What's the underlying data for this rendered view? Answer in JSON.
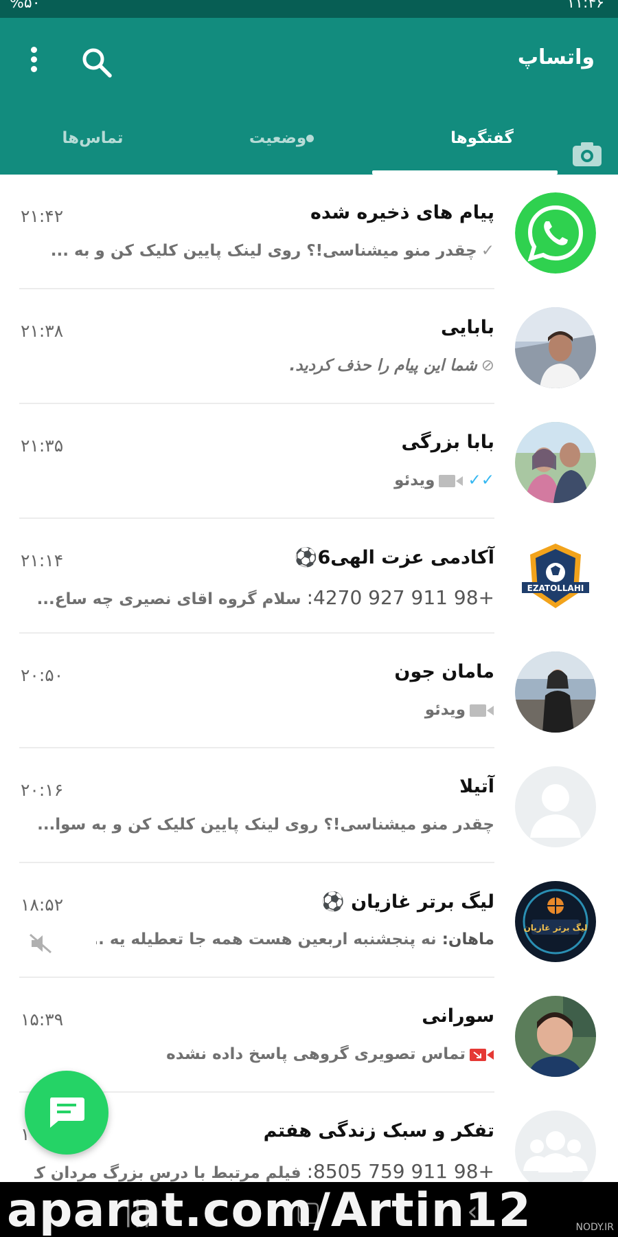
{
  "status_bar": {
    "left_text": "%۵۰",
    "right_text": "۱۱:۴۶"
  },
  "header": {
    "app_title": "واتساپ",
    "tabs": [
      {
        "label": "گفتگوها",
        "active": true
      },
      {
        "label": "وضعیت",
        "active": false
      },
      {
        "label": "تماس‌ها",
        "active": false
      }
    ]
  },
  "chats": [
    {
      "name": "پیام های ذخیره شده",
      "time": "۲۱:۴۲",
      "status_glyph": "✓",
      "preview": "چقدر منو میشناسی!؟ روی لینک پایین کلیک کن و به ...",
      "avatar": "whatsapp-logo"
    },
    {
      "name": "بابایی",
      "time": "۲۱:۳۸",
      "status_glyph": "⃠",
      "preview": "شما این پیام را حذف کردید.",
      "avatar": "photo-man-selfie"
    },
    {
      "name": "بابا بزرگی",
      "time": "۲۱:۳۵",
      "status_glyph": "✓✓",
      "preview": "ویدئو",
      "avatar": "photo-couple"
    },
    {
      "name": "آکادمی عزت الهی6⚽",
      "time": "۲۱:۱۴",
      "sender": "+98 911 927 4270:",
      "preview": "سلام گروه اقای نصیری چه ساع...",
      "avatar": "ezatollahi-logo"
    },
    {
      "name": "مامان جون",
      "time": "۲۰:۵۰",
      "preview": "ویدئو",
      "avatar": "photo-woman-beach"
    },
    {
      "name": "آتیلا",
      "time": "۲۰:۱۶",
      "preview": "چقدر منو میشناسی!؟ روی لینک پایین کلیک کن و به سوا...",
      "avatar": "default-person"
    },
    {
      "name": "لیگ برتر غازیان ⚽",
      "time": "۱۸:۵۲",
      "sender": "ماهان:",
      "preview": "نه پنجشنبه اربعین هست همه جا تعطیله یه ...",
      "avatar": "league-logo",
      "muted": true
    },
    {
      "name": "سورانی",
      "time": "۱۵:۳۹",
      "preview": "تماس تصویری گروهی پاسخ داده نشده",
      "avatar": "photo-boy"
    },
    {
      "name": "تفکر و سبک زندگی هفتم",
      "time": "۱",
      "sender": "+98 911 759 8505:",
      "preview": "فیلم مرتبط با درس بزرگ مردان ک...",
      "avatar": "default-group"
    }
  ],
  "league_logo_text": "لیگ برتر غازیان",
  "academy_logo_text": "EZATOLLAHI",
  "watermark": "aparat.com/Artin12",
  "watermark_small": "NODY.IR",
  "colors": {
    "header": "#128c7e",
    "status_bar": "#075e54",
    "fab": "#25d366",
    "read_ticks": "#34b7f1",
    "missed_call": "#e53935"
  }
}
